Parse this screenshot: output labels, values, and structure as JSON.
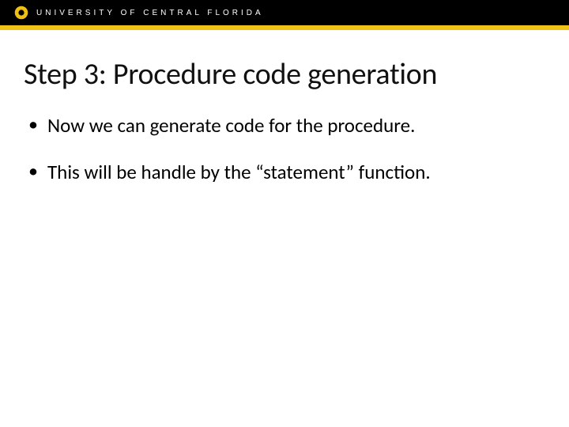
{
  "header": {
    "university": "UNIVERSITY OF CENTRAL FLORIDA",
    "logo_color": "#f3c216"
  },
  "slide": {
    "title": "Step 3: Procedure code generation",
    "bullets": [
      "Now we can generate code for the procedure.",
      "This will be handle by the “statement” function."
    ]
  }
}
